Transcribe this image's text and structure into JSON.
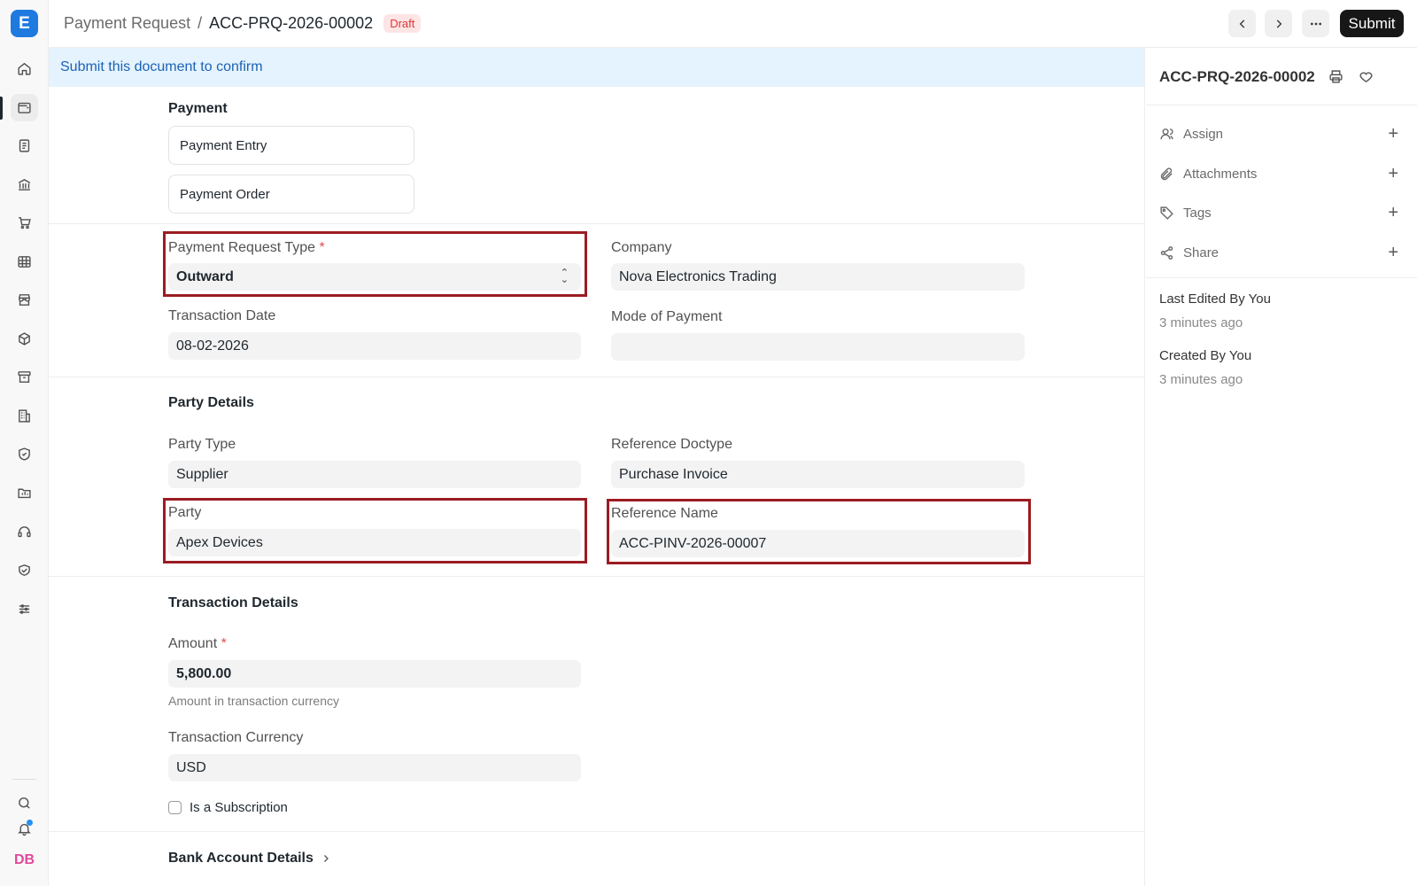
{
  "app": {
    "logo_letter": "E"
  },
  "header": {
    "breadcrumb_parent": "Payment Request",
    "breadcrumb_separator": "/",
    "doc_name": "ACC-PRQ-2026-00002",
    "status": "Draft",
    "submit_label": "Submit"
  },
  "banner": {
    "text": "Submit this document to confirm"
  },
  "payment_section": {
    "title": "Payment",
    "buttons": [
      "Payment Entry",
      "Payment Order"
    ]
  },
  "fields": {
    "payment_request_type": {
      "label": "Payment Request Type",
      "value": "Outward",
      "required": "*"
    },
    "company": {
      "label": "Company",
      "value": "Nova Electronics Trading"
    },
    "transaction_date": {
      "label": "Transaction Date",
      "value": "08-02-2026"
    },
    "mode_of_payment": {
      "label": "Mode of Payment",
      "value": ""
    }
  },
  "party_details": {
    "title": "Party Details",
    "party_type": {
      "label": "Party Type",
      "value": "Supplier"
    },
    "reference_doctype": {
      "label": "Reference Doctype",
      "value": "Purchase Invoice"
    },
    "party": {
      "label": "Party",
      "value": "Apex Devices"
    },
    "reference_name": {
      "label": "Reference Name",
      "value": "ACC-PINV-2026-00007"
    }
  },
  "transaction_details": {
    "title": "Transaction Details",
    "amount": {
      "label": "Amount",
      "value": "5,800.00",
      "required": "*",
      "help": "Amount in transaction currency"
    },
    "currency": {
      "label": "Transaction Currency",
      "value": "USD"
    },
    "subscription_label": "Is a Subscription"
  },
  "bank_section": {
    "title": "Bank Account Details"
  },
  "sidebar": {
    "doc_name": "ACC-PRQ-2026-00002",
    "actions": [
      {
        "label": "Assign",
        "icon": "user-icon"
      },
      {
        "label": "Attachments",
        "icon": "paperclip-icon"
      },
      {
        "label": "Tags",
        "icon": "tag-icon"
      },
      {
        "label": "Share",
        "icon": "share-icon"
      }
    ],
    "last_edited_label": "Last Edited By You",
    "last_edited_time": "3 minutes ago",
    "created_label": "Created By You",
    "created_time": "3 minutes ago"
  },
  "user": {
    "initials": "DB"
  },
  "colors": {
    "accent": "#1f7ae0",
    "highlight": "#9b1c22",
    "banner_bg": "#e4f3fd",
    "draft_badge": "#e03636"
  }
}
